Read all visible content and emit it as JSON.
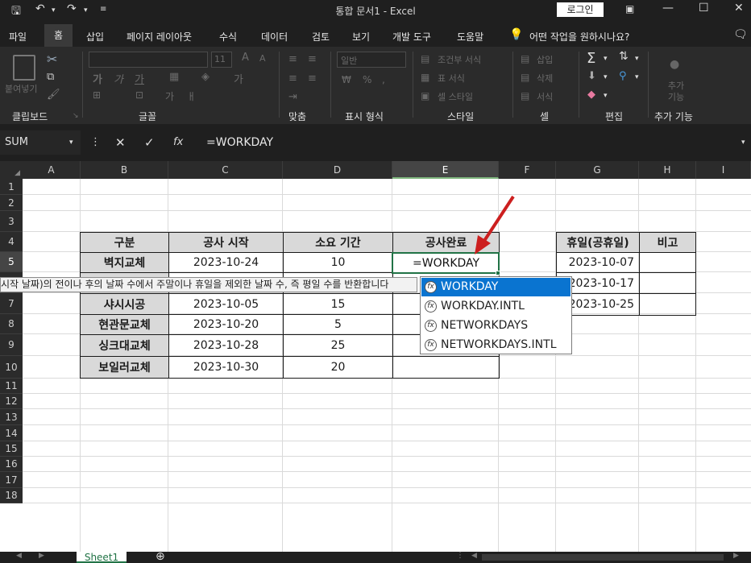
{
  "titlebar": {
    "title": "통합 문서1  -  Excel",
    "login_label": "로그인",
    "icons": [
      "save-icon",
      "undo-icon",
      "redo-icon",
      "customize-icon",
      "ribbon-display-icon",
      "minimize-icon",
      "restore-icon",
      "close-icon"
    ]
  },
  "menu": {
    "items": [
      "파일",
      "홈",
      "삽입",
      "페이지 레이아웃",
      "수식",
      "데이터",
      "검토",
      "보기",
      "개발 도구",
      "도움말"
    ],
    "search_label": "어떤 작업을 원하시나요?"
  },
  "ribbon": {
    "groups": [
      "클립보드",
      "글꼴",
      "맞춤",
      "표시 형식",
      "스타일",
      "셀",
      "편집",
      "추가 기능"
    ],
    "paste_label": "붙여넣기",
    "font_size": "11",
    "number_format": "일반",
    "style_items": [
      "조건부 서식",
      "표 서식",
      "셀 스타일"
    ],
    "cell_items": [
      "삽입",
      "삭제",
      "서식"
    ],
    "addin_label": "추가 기능"
  },
  "formula_bar": {
    "name_box": "SUM",
    "formula": "=WORKDAY"
  },
  "grid": {
    "columns": [
      "A",
      "B",
      "C",
      "D",
      "E",
      "F",
      "G",
      "H",
      "I"
    ],
    "rows": [
      "1",
      "2",
      "3",
      "4",
      "5",
      "6",
      "7",
      "8",
      "9",
      "10",
      "11",
      "12",
      "13",
      "14",
      "15",
      "16",
      "17",
      "18"
    ]
  },
  "table_main": {
    "headers": [
      "구분",
      "공사 시작",
      "소요 기간",
      "공사완료"
    ],
    "rows": [
      [
        "벽지교체",
        "2023-10-24",
        "10"
      ],
      [
        "",
        "",
        ""
      ],
      [
        "샤시시공",
        "2023-10-05",
        "15"
      ],
      [
        "현관문교체",
        "2023-10-20",
        "5"
      ],
      [
        "싱크대교체",
        "2023-10-28",
        "25"
      ],
      [
        "보일러교체",
        "2023-10-30",
        "20"
      ]
    ],
    "active_value": "=WORKDAY"
  },
  "table_holiday": {
    "headers": [
      "휴일(공휴일)",
      "비고"
    ],
    "rows": [
      "2023-10-07",
      "2023-10-17",
      "2023-10-25"
    ]
  },
  "tooltip": "시작 날짜)의 전이나 후의 날짜 수에서 주말이나 휴일을 제외한 날짜 수, 즉 평일 수를 반환합니다",
  "autocomplete": {
    "items": [
      "WORKDAY",
      "WORKDAY.INTL",
      "NETWORKDAYS",
      "NETWORKDAYS.INTL"
    ]
  },
  "sheets": {
    "active": "Sheet1"
  },
  "colors": {
    "accent": "#217346",
    "selection": "#0a74d0",
    "annotation_arrow": "#cc1f1f"
  }
}
